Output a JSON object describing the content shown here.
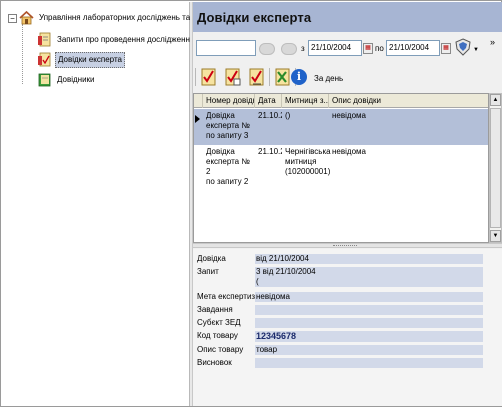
{
  "tree": {
    "root": "Управління лабораторних досліджень та експертиз",
    "expander": "−",
    "items": [
      {
        "label": "Запити про проведення дослідження"
      },
      {
        "label": "Довідки експерта"
      },
      {
        "label": "Довідники"
      }
    ]
  },
  "pane_title": "Довідки експерта",
  "filter": {
    "from_label": "з",
    "from_date": "21/10/2004",
    "to_label": "по",
    "to_date": "21/10/2004",
    "overflow": "»",
    "dropdown_arrow": "▼"
  },
  "toolbar": {
    "per_day_label": "За день"
  },
  "grid": {
    "columns": [
      "Номер довідки",
      "Дата",
      "Митниця з...",
      "Опис довідки"
    ],
    "rows": [
      {
        "number": "Довідка\nексперта №\nпо запиту 3",
        "date": "21.10.2(",
        "customs": "()",
        "description": "невідома"
      },
      {
        "number": "Довідка\nексперта № 2\nпо запиту 2",
        "date": "21.10.2(",
        "customs": "Чернігівська\nмитниця\n(102000001)",
        "description": "невідома"
      }
    ]
  },
  "details": {
    "fields": [
      {
        "label": "Довідка",
        "value": "від 21/10/2004"
      },
      {
        "label": "Запит",
        "value": "3 від 21/10/2004\n("
      },
      {
        "label": "Мета експертизи",
        "value": "невідома"
      },
      {
        "label": "Завдання",
        "value": ""
      },
      {
        "label": "Субєкт ЗЕД",
        "value": ""
      },
      {
        "label": "Код товару",
        "value": "12345678"
      },
      {
        "label": "Опис товару",
        "value": "товар"
      },
      {
        "label": "Висновок",
        "value": ""
      }
    ]
  },
  "colors": {
    "title_bar": "#a7b5d3",
    "selected_row": "#b3bfd8",
    "detail_value_bg": "#d2d9e9",
    "info_icon": "#1f62c9"
  }
}
